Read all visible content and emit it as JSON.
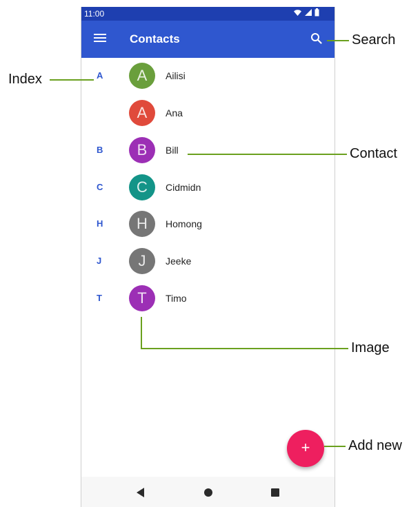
{
  "status_bar": {
    "time": "11:00"
  },
  "app_bar": {
    "title": "Contacts"
  },
  "contacts": [
    {
      "index": "A",
      "initial": "A",
      "name": "Ailisi",
      "color": "#6a9f3c"
    },
    {
      "index": "",
      "initial": "A",
      "name": "Ana",
      "color": "#e04a3b"
    },
    {
      "index": "B",
      "initial": "B",
      "name": "Bill",
      "color": "#9c2fb5"
    },
    {
      "index": "C",
      "initial": "C",
      "name": "Cidmidn",
      "color": "#139488"
    },
    {
      "index": "H",
      "initial": "H",
      "name": "Homong",
      "color": "#767676"
    },
    {
      "index": "J",
      "initial": "J",
      "name": "Jeeke",
      "color": "#767676"
    },
    {
      "index": "T",
      "initial": "T",
      "name": "Timo",
      "color": "#9c2fb5"
    }
  ],
  "fab": {
    "symbol": "+"
  },
  "callouts": {
    "index": "Index",
    "search": "Search",
    "contact": "Contact",
    "image": "Image",
    "add_new": "Add new"
  },
  "colors": {
    "status_bar": "#1e3fb0",
    "app_bar": "#2f57cf",
    "accent": "#2f57cf",
    "fab": "#ee1f5f",
    "callout_line": "#6aa01e"
  },
  "icons": [
    "menu-icon",
    "search-icon",
    "wifi-icon",
    "signal-icon",
    "battery-icon",
    "plus-icon",
    "back-icon",
    "home-icon",
    "recents-icon"
  ]
}
